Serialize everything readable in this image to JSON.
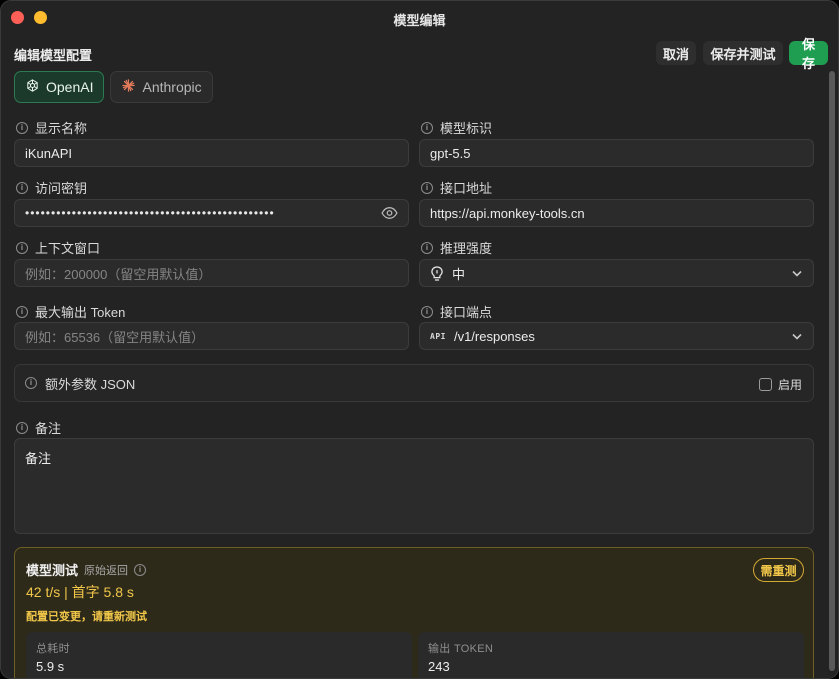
{
  "window": {
    "title": "模型编辑"
  },
  "header": {
    "title": "编辑模型配置",
    "cancel_label": "取消",
    "save_test_label": "保存并测试",
    "save_label": "保存"
  },
  "tabs": [
    {
      "label": "OpenAI",
      "icon": "openai-icon",
      "active": true
    },
    {
      "label": "Anthropic",
      "icon": "anthropic-icon",
      "active": false
    }
  ],
  "fields": {
    "display_name": {
      "label": "显示名称",
      "value": "iKunAPI"
    },
    "model_id": {
      "label": "模型标识",
      "value": "gpt-5.5"
    },
    "api_key": {
      "label": "访问密钥",
      "value": "••••••••••••••••••••••••••••••••••••••••••••••••"
    },
    "endpoint_url": {
      "label": "接口地址",
      "value": "https://api.monkey-tools.cn"
    },
    "context_window": {
      "label": "上下文窗口",
      "placeholder": "例如：200000（留空用默认值）"
    },
    "reasoning": {
      "label": "推理强度",
      "value": "中"
    },
    "max_output": {
      "label": "最大输出 Token",
      "placeholder": "例如：65536（留空用默认值）"
    },
    "api_endpoint": {
      "label": "接口端点",
      "badge": "API",
      "value": "/v1/responses"
    }
  },
  "extra_params": {
    "label": "额外参数 JSON",
    "enable_label": "启用",
    "enabled": false
  },
  "notes": {
    "label": "备注",
    "value": "备注"
  },
  "test": {
    "title": "模型测试",
    "raw_label": "原始返回",
    "rate": "42 t/s | 首字 5.8 s",
    "warning": "配置已变更，请重新测试",
    "retest_label": "需重测",
    "stats": [
      {
        "label": "总耗时",
        "value": "5.9 s"
      },
      {
        "label": "输出 TOKEN",
        "value": "243"
      }
    ]
  },
  "colors": {
    "accent": "#1f9e52",
    "warning": "#f1c749",
    "panel_border": "#6f5f25"
  }
}
